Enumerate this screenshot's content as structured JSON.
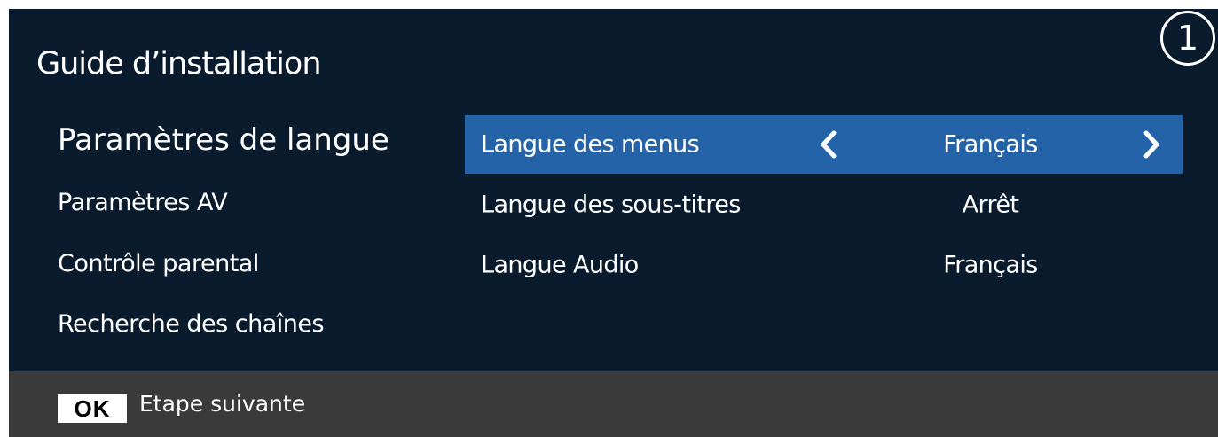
{
  "step": "1",
  "title": "Guide d’installation",
  "nav": {
    "items": [
      {
        "label": "Paramètres de langue"
      },
      {
        "label": "Paramètres AV"
      },
      {
        "label": "Contrôle parental"
      },
      {
        "label": "Recherche des chaînes"
      }
    ],
    "active_index": 0
  },
  "settings": {
    "rows": [
      {
        "label": "Langue des menus",
        "value": "Français"
      },
      {
        "label": "Langue des sous-titres",
        "value": "Arrêt"
      },
      {
        "label": "Langue Audio",
        "value": "Français"
      }
    ],
    "selected_index": 0
  },
  "footer": {
    "key": "OK",
    "label": "Etape suivante"
  },
  "icons": {
    "prev": "chevron-left-icon",
    "next": "chevron-right-icon"
  },
  "colors": {
    "background": "#0b1b2e",
    "highlight": "#2563a8",
    "footer": "#3a3a3a",
    "text": "#ffffff"
  }
}
